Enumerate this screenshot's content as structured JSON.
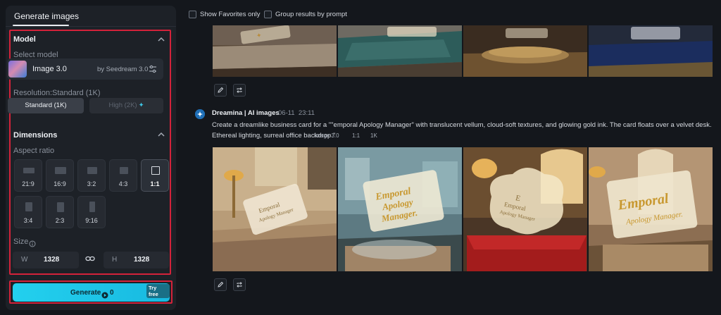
{
  "left_panel": {
    "tab": "Generate images",
    "model": {
      "section_title": "Model",
      "select_label": "Select model",
      "name": "Image 3.0",
      "provider": "by Seedream 3.0"
    },
    "resolution": {
      "label": "Resolution:Standard (1K)",
      "standard": "Standard (1K)",
      "high": "High (2K)"
    },
    "dimensions": {
      "section_title": "Dimensions",
      "aspect_label": "Aspect ratio",
      "ratios": [
        "21:9",
        "16:9",
        "3:2",
        "4:3",
        "1:1",
        "3:4",
        "2:3",
        "9:16"
      ],
      "selected": "1:1"
    },
    "size": {
      "label": "Size",
      "w_prefix": "W",
      "w_value": "1328",
      "h_prefix": "H",
      "h_value": "1328"
    },
    "generate": {
      "label": "Generate",
      "credits": "0",
      "badge": "Try free"
    }
  },
  "top_filters": {
    "show_favorites": "Show Favorites only",
    "group_by_prompt": "Group results by prompt"
  },
  "result": {
    "author": "Dreamina | AI images",
    "date": "06-11",
    "time": "23:11",
    "prompt": "Create a dreamlike business card for a \"\"emporal Apology Manager\" with translucent vellum, cloud-soft textures, and glowing gold ink. The card floats over a velvet desk. Ethereal lighting, surreal office backdrop.\"",
    "tags": [
      "Image 3.0",
      "1:1",
      "1K"
    ]
  },
  "image_text": {
    "line1": "Emporal",
    "line2": "Apology",
    "line3": "Manager.",
    "card1_line1": "Emporal",
    "card1_line2": "Apology Manager"
  },
  "colors": {
    "accent": "#23d0ee",
    "highlight": "#d4223a",
    "panel": "#1d2127",
    "background": "#14171c"
  }
}
